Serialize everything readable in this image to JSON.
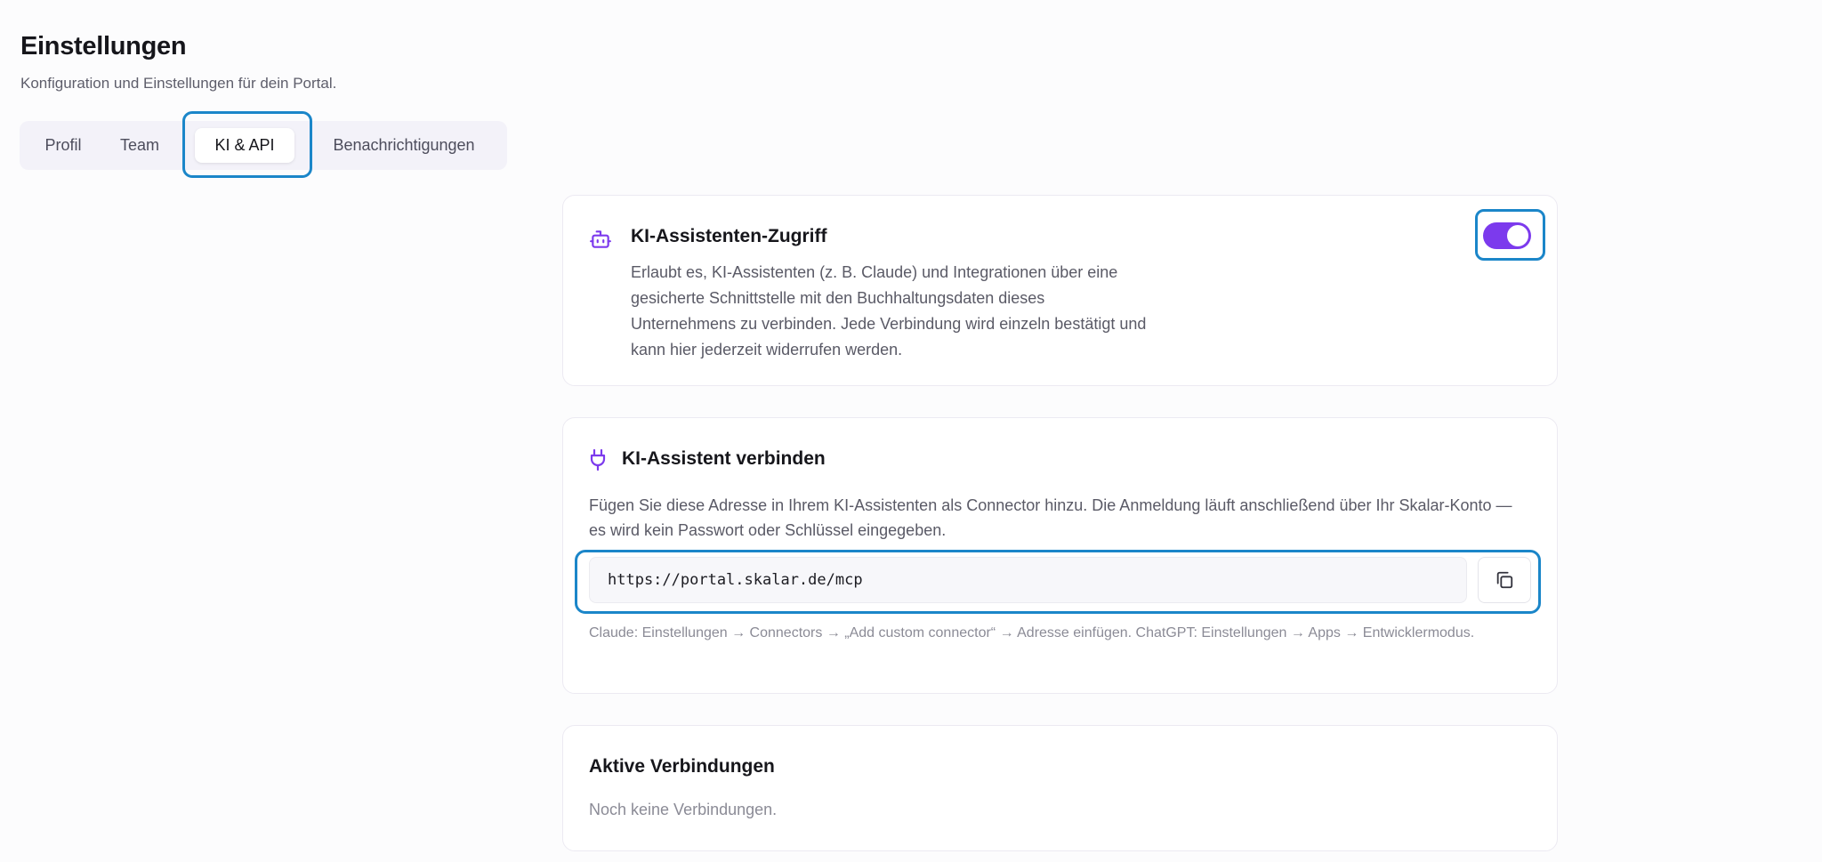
{
  "page": {
    "title": "Einstellungen",
    "subtitle": "Konfiguration und Einstellungen für dein Portal."
  },
  "tabs": [
    {
      "label": "Profil",
      "active": false
    },
    {
      "label": "Team",
      "active": false
    },
    {
      "label": "KI & API",
      "active": true
    },
    {
      "label": "Benachrichtigungen",
      "active": false
    }
  ],
  "access_card": {
    "icon": "bot-icon",
    "title": "KI-Assistenten-Zugriff",
    "description": "Erlaubt es, KI-Assistenten (z. B. Claude) und Integrationen über eine gesicherte Schnittstelle mit den Buchhaltungsdaten dieses Unternehmens zu verbinden. Jede Verbindung wird einzeln bestätigt und kann hier jederzeit widerrufen werden.",
    "toggle_enabled": true
  },
  "connect_card": {
    "icon": "plug-icon",
    "title": "KI-Assistent verbinden",
    "description": "Fügen Sie diese Adresse in Ihrem KI-Assistenten als Connector hinzu. Die Anmeldung läuft anschließend über Ihr Skalar-Konto — es wird kein Passwort oder Schlüssel eingegeben.",
    "url": "https://portal.skalar.de/mcp",
    "copy_icon": "copy-icon",
    "hint": "Claude: Einstellungen → Connectors → „Add custom connector“ → Adresse einfügen. ChatGPT: Einstellungen → Apps → Entwicklermodus."
  },
  "connections_card": {
    "title": "Aktive Verbindungen",
    "empty_text": "Noch keine Verbindungen."
  },
  "colors": {
    "accent": "#7c3aed",
    "highlight": "#1b86c9"
  }
}
